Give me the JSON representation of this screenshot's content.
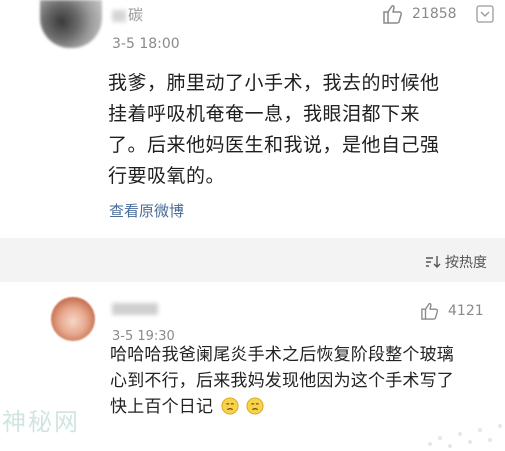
{
  "comment_1": {
    "username": "碳",
    "time": "3-5 18:00",
    "likes": "21858",
    "content_lines": [
      "我爹，肺里动了小手术，我去的时候他",
      "挂着呼吸机奄奄一息，我眼泪都下来",
      "了。后来他妈医生和我说，是他自己强",
      "行要吸氧的。"
    ],
    "view_original_label": "查看原微博"
  },
  "section": {
    "sort_label": "按热度"
  },
  "comment_2": {
    "time": "3-5 19:30",
    "likes": "4121",
    "content_lines": [
      "哈哈哈我爸阑尾炎手术之后恢复阶段整个玻璃",
      "心到不行，后来我妈发现他因为这个手术写了",
      "快上百个日记"
    ]
  },
  "watermark": "神秘网"
}
